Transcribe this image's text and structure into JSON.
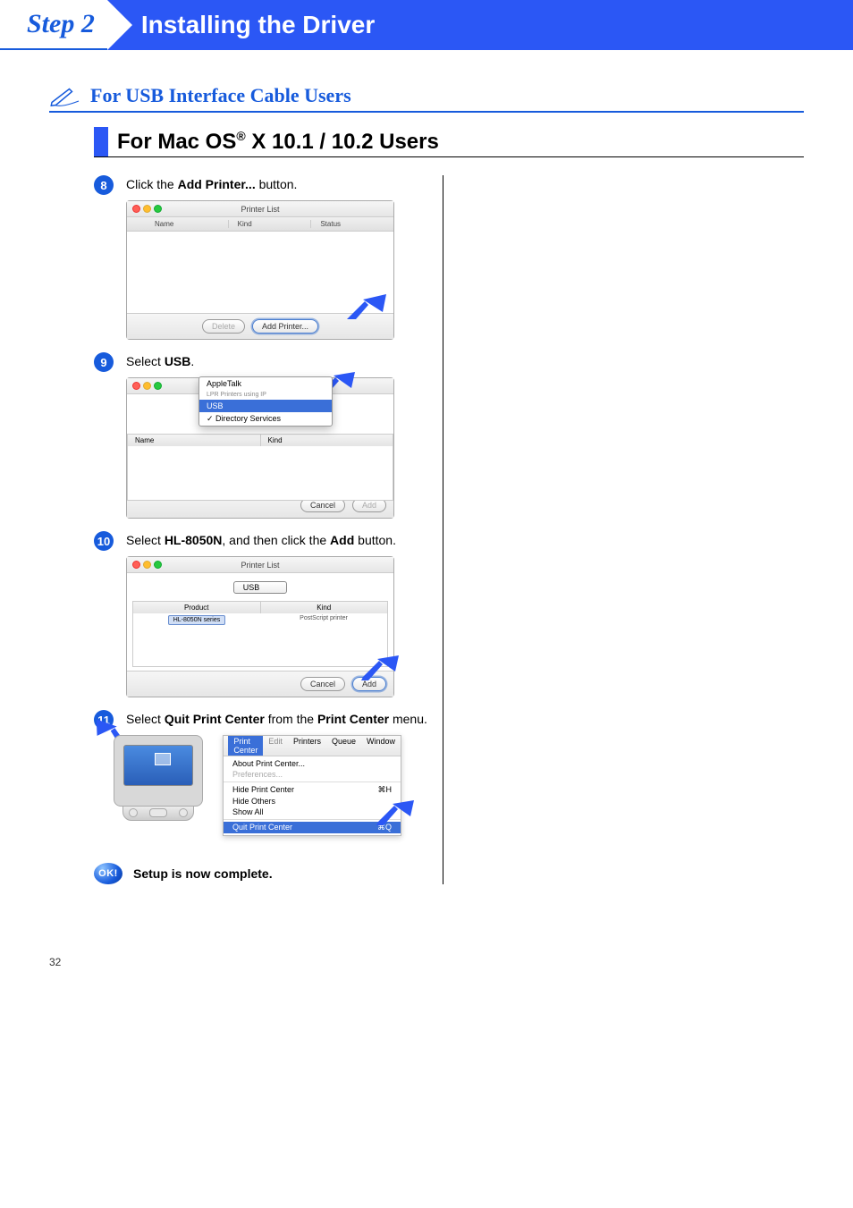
{
  "header": {
    "step_label": "Step 2",
    "title": "Installing the Driver"
  },
  "section_heading": "For USB Interface Cable Users",
  "subheading_prefix": "For Mac OS",
  "subheading_reg": "®",
  "subheading_suffix": " X 10.1 / 10.2 Users",
  "steps": {
    "s8": {
      "num": "8",
      "pre": "Click the ",
      "b1": "Add Printer...",
      "post": " button."
    },
    "s9": {
      "num": "9",
      "pre": "Select ",
      "b1": "USB",
      "post": "."
    },
    "s10": {
      "num": "10",
      "pre": "Select ",
      "b1": "HL-8050N",
      "mid": ", and then click the ",
      "b2": "Add",
      "post": " button."
    },
    "s11": {
      "num": "11",
      "pre": "Select ",
      "b1": "Quit Print Center",
      "mid": " from the ",
      "b2": "Print Center",
      "post": " menu."
    }
  },
  "win1": {
    "title": "Printer List",
    "col_name": "Name",
    "col_kind": "Kind",
    "col_status": "Status",
    "btn_delete": "Delete",
    "btn_add": "Add Printer..."
  },
  "win2": {
    "opt_appletalk": "AppleTalk",
    "opt_lpr": "LPR Printers using IP",
    "opt_usb": "USB",
    "opt_dir": "✓ Directory Services",
    "col_name": "Name",
    "col_kind": "Kind",
    "btn_cancel": "Cancel",
    "btn_add": "Add"
  },
  "win3": {
    "title": "Printer List",
    "select_usb": "USB",
    "col_product": "Product",
    "col_kind": "Kind",
    "row_product": "HL-8050N series",
    "row_kind": "PostScript printer",
    "btn_cancel": "Cancel",
    "btn_add": "Add"
  },
  "menu": {
    "apple": "",
    "m_printcenter": "Print Center",
    "m_edit": "Edit",
    "m_printers": "Printers",
    "m_queue": "Queue",
    "m_window": "Window",
    "about": "About Print Center...",
    "prefs": "Preferences...",
    "hide_pc": "Hide Print Center",
    "hide_pc_sc": "⌘H",
    "hide_others": "Hide Others",
    "show_all": "Show All",
    "quit": "Quit Print Center",
    "quit_sc": "⌘Q"
  },
  "ok": {
    "badge": "OK!",
    "text": "Setup is now complete."
  },
  "page_number": "32"
}
